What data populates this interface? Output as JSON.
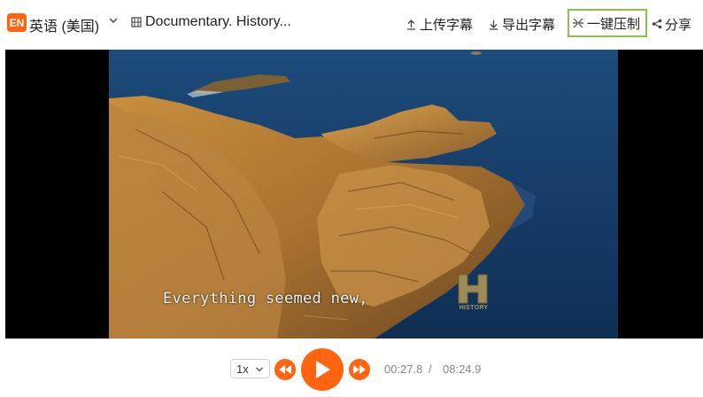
{
  "colors": {
    "accent": "#ff6410",
    "highlight_border": "#8bc34a"
  },
  "header": {
    "lang_badge": "EN",
    "language": "英语 (美国)",
    "doc_title": "Documentary. History...",
    "actions": {
      "upload": "上传字幕",
      "export": "导出字幕",
      "burn": "一键压制",
      "share": "分享"
    }
  },
  "video": {
    "subtitle": "Everything seemed new,",
    "watermark_text": "HISTORY"
  },
  "controls": {
    "speed": "1x",
    "current_time": "00:27.8",
    "separator": "/",
    "duration": "08:24.9"
  },
  "icons": [
    "chevron-down-icon",
    "film-icon",
    "upload-icon",
    "download-icon",
    "sparkle-icon",
    "share-icon",
    "rewind-icon",
    "play-icon",
    "fast-forward-icon"
  ]
}
